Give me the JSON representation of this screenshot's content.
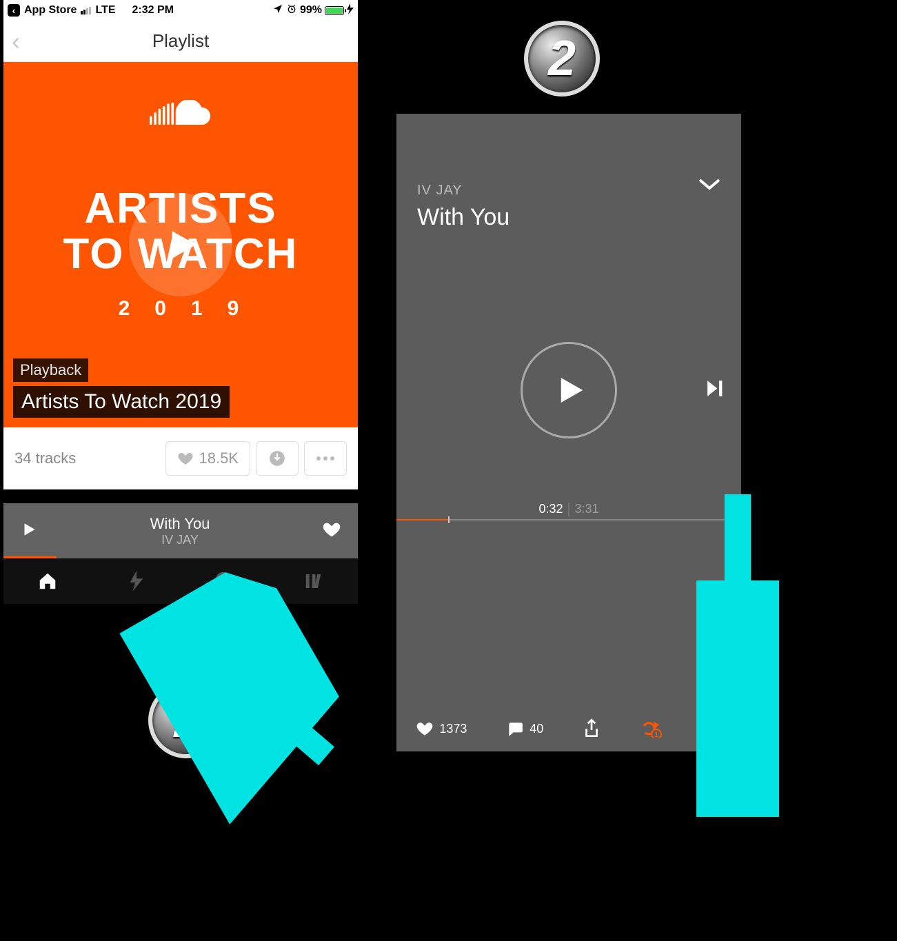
{
  "steps": {
    "one": "1",
    "two": "2"
  },
  "statusbar": {
    "back_app": "App Store",
    "network": "LTE",
    "time": "2:32 PM",
    "battery_pct": "99%",
    "battery_fill_pct": 99
  },
  "navheader": {
    "title": "Playlist"
  },
  "cover": {
    "line1": "ARTISTS",
    "line2": "TO WATCH",
    "year": "2019",
    "pill_small": "Playback",
    "pill_big": "Artists To Watch 2019"
  },
  "stats": {
    "tracks_label": "34 tracks",
    "likes": "18.5K"
  },
  "miniplayer": {
    "title": "With You",
    "artist": "IV JAY",
    "progress_pct": 15
  },
  "nowplaying": {
    "artist": "IV JAY",
    "title": "With You",
    "elapsed": "0:32",
    "duration": "3:31",
    "progress_pct": 15,
    "likes": "1373",
    "comments": "40"
  },
  "icons": {
    "heart": "heart-icon",
    "download": "download-icon",
    "more": "more-icon",
    "home": "home-icon",
    "bolt": "bolt-icon",
    "search": "search-icon",
    "library": "library-icon",
    "comment": "comment-icon",
    "share": "share-icon",
    "repeat": "repeat-one-icon",
    "chevron_down": "chevron-down-icon",
    "next": "next-track-icon",
    "play": "play-icon",
    "location": "location-icon",
    "alarm": "alarm-icon",
    "charging": "charging-icon"
  },
  "colors": {
    "accent": "#fd5500",
    "annotation": "#00e3e3"
  }
}
